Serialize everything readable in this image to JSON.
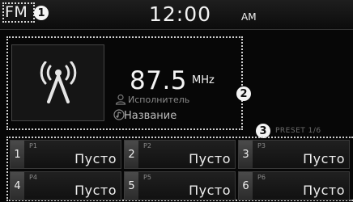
{
  "status_bar": {
    "source": "FM",
    "callout_1": "1",
    "time": "12:00",
    "ampm": "AM"
  },
  "station": {
    "frequency": "87.5",
    "unit": "MHz",
    "artist": "Исполнитель",
    "title": "Название",
    "callout_2": "2",
    "icons": [
      "antenna-icon",
      "person-icon",
      "music-note-icon"
    ]
  },
  "presets": {
    "page_label": "PRESET 1/6",
    "callout_3": "3",
    "items": [
      {
        "number": "1",
        "tag": "P1",
        "label": "Пусто"
      },
      {
        "number": "2",
        "tag": "P2",
        "label": "Пусто"
      },
      {
        "number": "3",
        "tag": "P3",
        "label": "Пусто"
      },
      {
        "number": "4",
        "tag": "P4",
        "label": "Пусто"
      },
      {
        "number": "5",
        "tag": "P5",
        "label": "Пусто"
      },
      {
        "number": "6",
        "tag": "P6",
        "label": "Пусто"
      }
    ]
  }
}
